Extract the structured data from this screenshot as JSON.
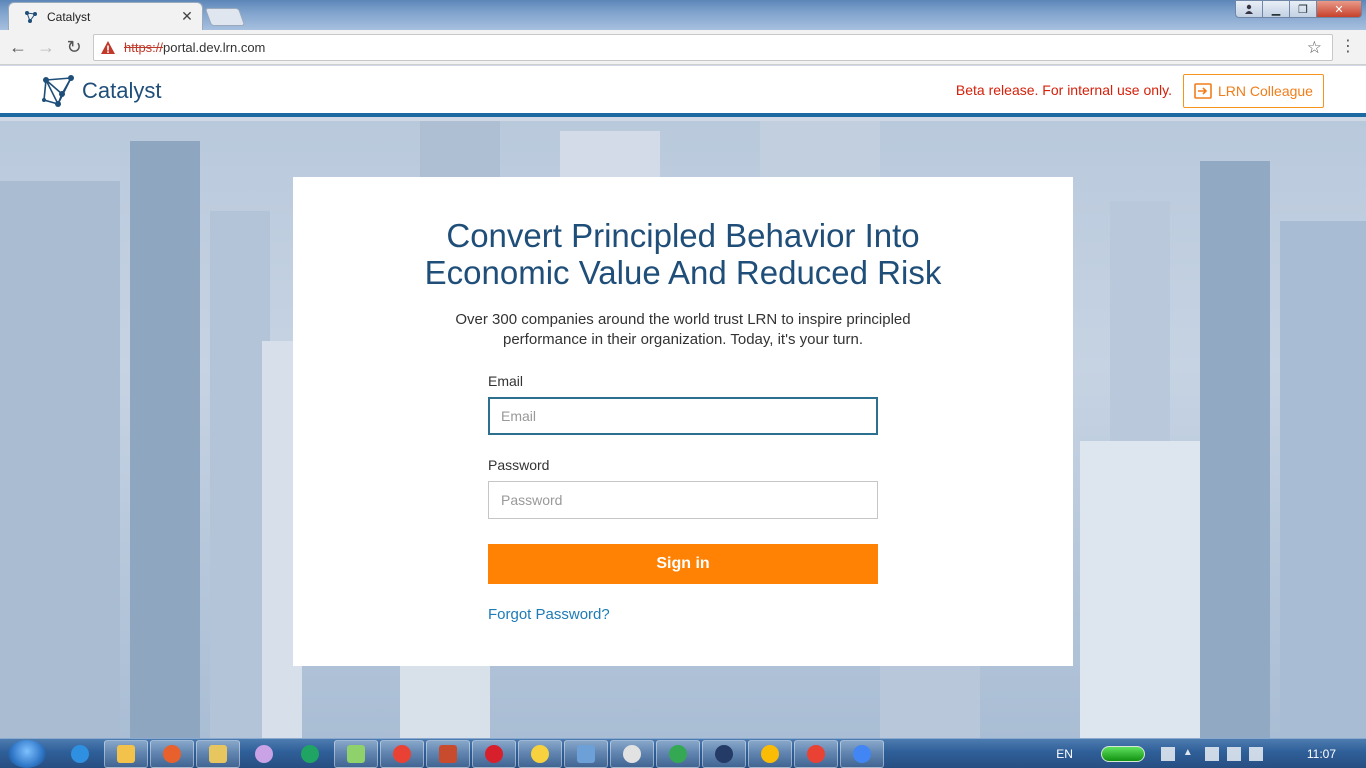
{
  "browser": {
    "tab_title": "Catalyst",
    "url_scheme": "https://",
    "url_rest": "portal.dev.lrn.com"
  },
  "header": {
    "logo_text": "Catalyst",
    "beta_notice": "Beta release. For internal use only.",
    "colleague_button": "LRN Colleague"
  },
  "login": {
    "headline_line1": "Convert Principled Behavior Into",
    "headline_line2": "Economic Value And Reduced Risk",
    "subtitle": "Over 300 companies around the world trust LRN to inspire principled performance in their organization. Today, it's your turn.",
    "email_label": "Email",
    "email_placeholder": "Email",
    "password_label": "Password",
    "password_placeholder": "Password",
    "signin_label": "Sign in",
    "forgot_label": "Forgot Password?"
  },
  "taskbar": {
    "language": "EN",
    "time": "11:07"
  },
  "colors": {
    "brand_blue": "#1f4e79",
    "accent_orange": "#ff8205",
    "beta_red": "#d6200a",
    "link_blue": "#1d7bb5"
  }
}
